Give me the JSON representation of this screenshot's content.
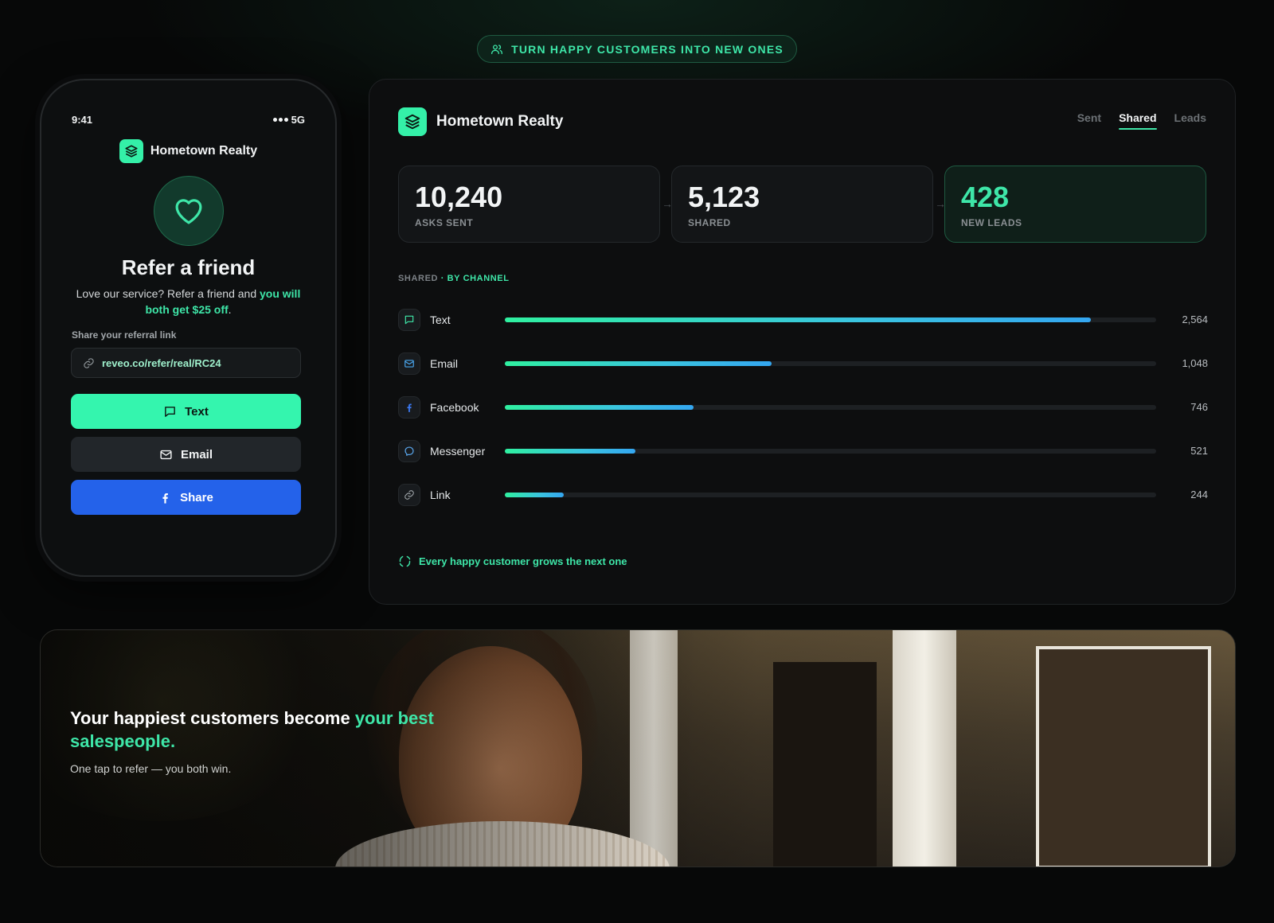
{
  "hero_pill": {
    "label": "TURN HAPPY CUSTOMERS INTO NEW ONES",
    "icon": "users-icon"
  },
  "phone": {
    "status_time": "9:41",
    "status_network": "5G",
    "brand_name": "Hometown Realty",
    "title": "Refer a friend",
    "description_plain": "Love our service? Refer a friend and ",
    "description_highlight": "you will both get $25 off",
    "description_end": ".",
    "share_label": "Share your referral link",
    "referral_link": "reveo.co/refer/real/RC24",
    "buttons": {
      "text": "Text",
      "email": "Email",
      "share": "Share"
    }
  },
  "dashboard": {
    "brand_name": "Hometown Realty",
    "tabs": [
      {
        "label": "Sent",
        "active": false
      },
      {
        "label": "Shared",
        "active": true
      },
      {
        "label": "Leads",
        "active": false
      }
    ],
    "stats": [
      {
        "value": "10,240",
        "label": "ASKS SENT"
      },
      {
        "value": "5,123",
        "label": "SHARED"
      },
      {
        "value": "428",
        "label": "NEW LEADS"
      }
    ],
    "section_label_prefix": "SHARED",
    "section_label_suffix": " · BY CHANNEL",
    "channels": [
      {
        "name": "Text",
        "value": "2,564",
        "share": 0.9,
        "icon": "chat-icon"
      },
      {
        "name": "Email",
        "value": "1,048",
        "share": 0.41,
        "icon": "mail-icon"
      },
      {
        "name": "Facebook",
        "value": "746",
        "share": 0.29,
        "icon": "facebook-icon"
      },
      {
        "name": "Messenger",
        "value": "521",
        "share": 0.2,
        "icon": "messenger-icon"
      },
      {
        "name": "Link",
        "value": "244",
        "share": 0.09,
        "icon": "link-icon"
      }
    ],
    "footer_note": "Every happy customer grows the next one"
  },
  "banner": {
    "title_plain": "Your happiest customers become ",
    "title_highlight": "your best salespeople.",
    "subtitle": "One tap to refer — you both win."
  },
  "colors": {
    "accent": "#3ee6a8",
    "facebook_blue": "#2462ea",
    "background": "#070808"
  }
}
